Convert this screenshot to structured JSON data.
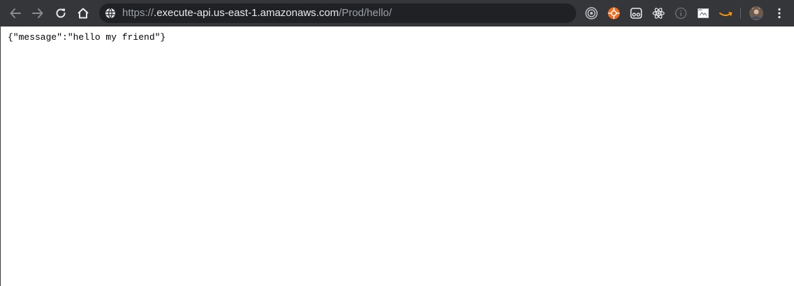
{
  "browser": {
    "toolbar_color": "#35363a",
    "omnibox_color": "#202124",
    "url": {
      "scheme": "https://",
      "host": ".execute-api.us-east-1.amazonaws.com",
      "path": "/Prod/hello/"
    },
    "nav_icons": [
      "back-arrow-icon",
      "forward-arrow-icon",
      "reload-icon",
      "home-icon"
    ],
    "extension_icons": [
      "target-icon",
      "orange-circle-extension-icon",
      "camera-extension-icon",
      "react-devtools-icon",
      "info-icon",
      "screenshot-extension-icon",
      "amazon-icon"
    ],
    "profile": "avatar",
    "menu": "more-vertical-icon"
  },
  "page": {
    "body_text": "{\"message\":\"hello my friend\"}"
  }
}
